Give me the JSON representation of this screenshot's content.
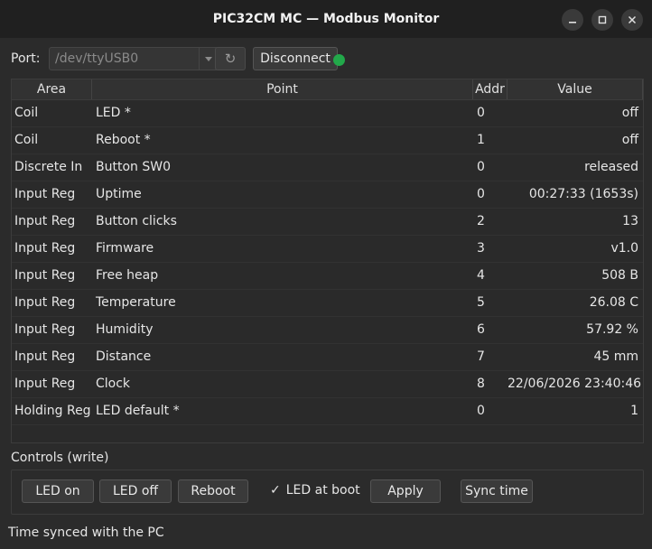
{
  "window": {
    "title": "PIC32CM MC — Modbus Monitor"
  },
  "icons": {
    "minimize": "minimize-icon",
    "maximize": "maximize-icon",
    "close": "close-icon",
    "refresh": "refresh-icon",
    "dropdown": "chevron-down-icon",
    "check": "checkmark-icon"
  },
  "colors": {
    "connected_indicator": "#22a84a"
  },
  "port": {
    "label": "Port:",
    "value": "/dev/ttyUSB0",
    "refresh_glyph": "↻",
    "connect_label": "Disconnect"
  },
  "table": {
    "headers": [
      "Area",
      "Point",
      "Addr",
      "Value"
    ],
    "rows": [
      {
        "area": "Coil",
        "point": "LED *",
        "addr": "0",
        "value": "off"
      },
      {
        "area": "Coil",
        "point": "Reboot *",
        "addr": "1",
        "value": "off"
      },
      {
        "area": "Discrete In",
        "point": "Button SW0",
        "addr": "0",
        "value": "released"
      },
      {
        "area": "Input Reg",
        "point": "Uptime",
        "addr": "0",
        "value": "00:27:33 (1653s)"
      },
      {
        "area": "Input Reg",
        "point": "Button clicks",
        "addr": "2",
        "value": "13"
      },
      {
        "area": "Input Reg",
        "point": "Firmware",
        "addr": "3",
        "value": "v1.0"
      },
      {
        "area": "Input Reg",
        "point": "Free heap",
        "addr": "4",
        "value": "508 B"
      },
      {
        "area": "Input Reg",
        "point": "Temperature",
        "addr": "5",
        "value": "26.08 C"
      },
      {
        "area": "Input Reg",
        "point": "Humidity",
        "addr": "6",
        "value": "57.92 %"
      },
      {
        "area": "Input Reg",
        "point": "Distance",
        "addr": "7",
        "value": "45 mm"
      },
      {
        "area": "Input Reg",
        "point": "Clock",
        "addr": "8",
        "value": "22/06/2026 23:40:46"
      },
      {
        "area": "Holding Reg",
        "point": "LED default *",
        "addr": "0",
        "value": "1"
      }
    ]
  },
  "controls": {
    "label": "Controls (write)",
    "led_on": "LED on",
    "led_off": "LED off",
    "reboot": "Reboot",
    "check_glyph": "✓",
    "led_at_boot": "LED at boot",
    "led_at_boot_checked": true,
    "apply": "Apply",
    "sync_time": "Sync time"
  },
  "status": {
    "text": "Time synced with the PC"
  }
}
